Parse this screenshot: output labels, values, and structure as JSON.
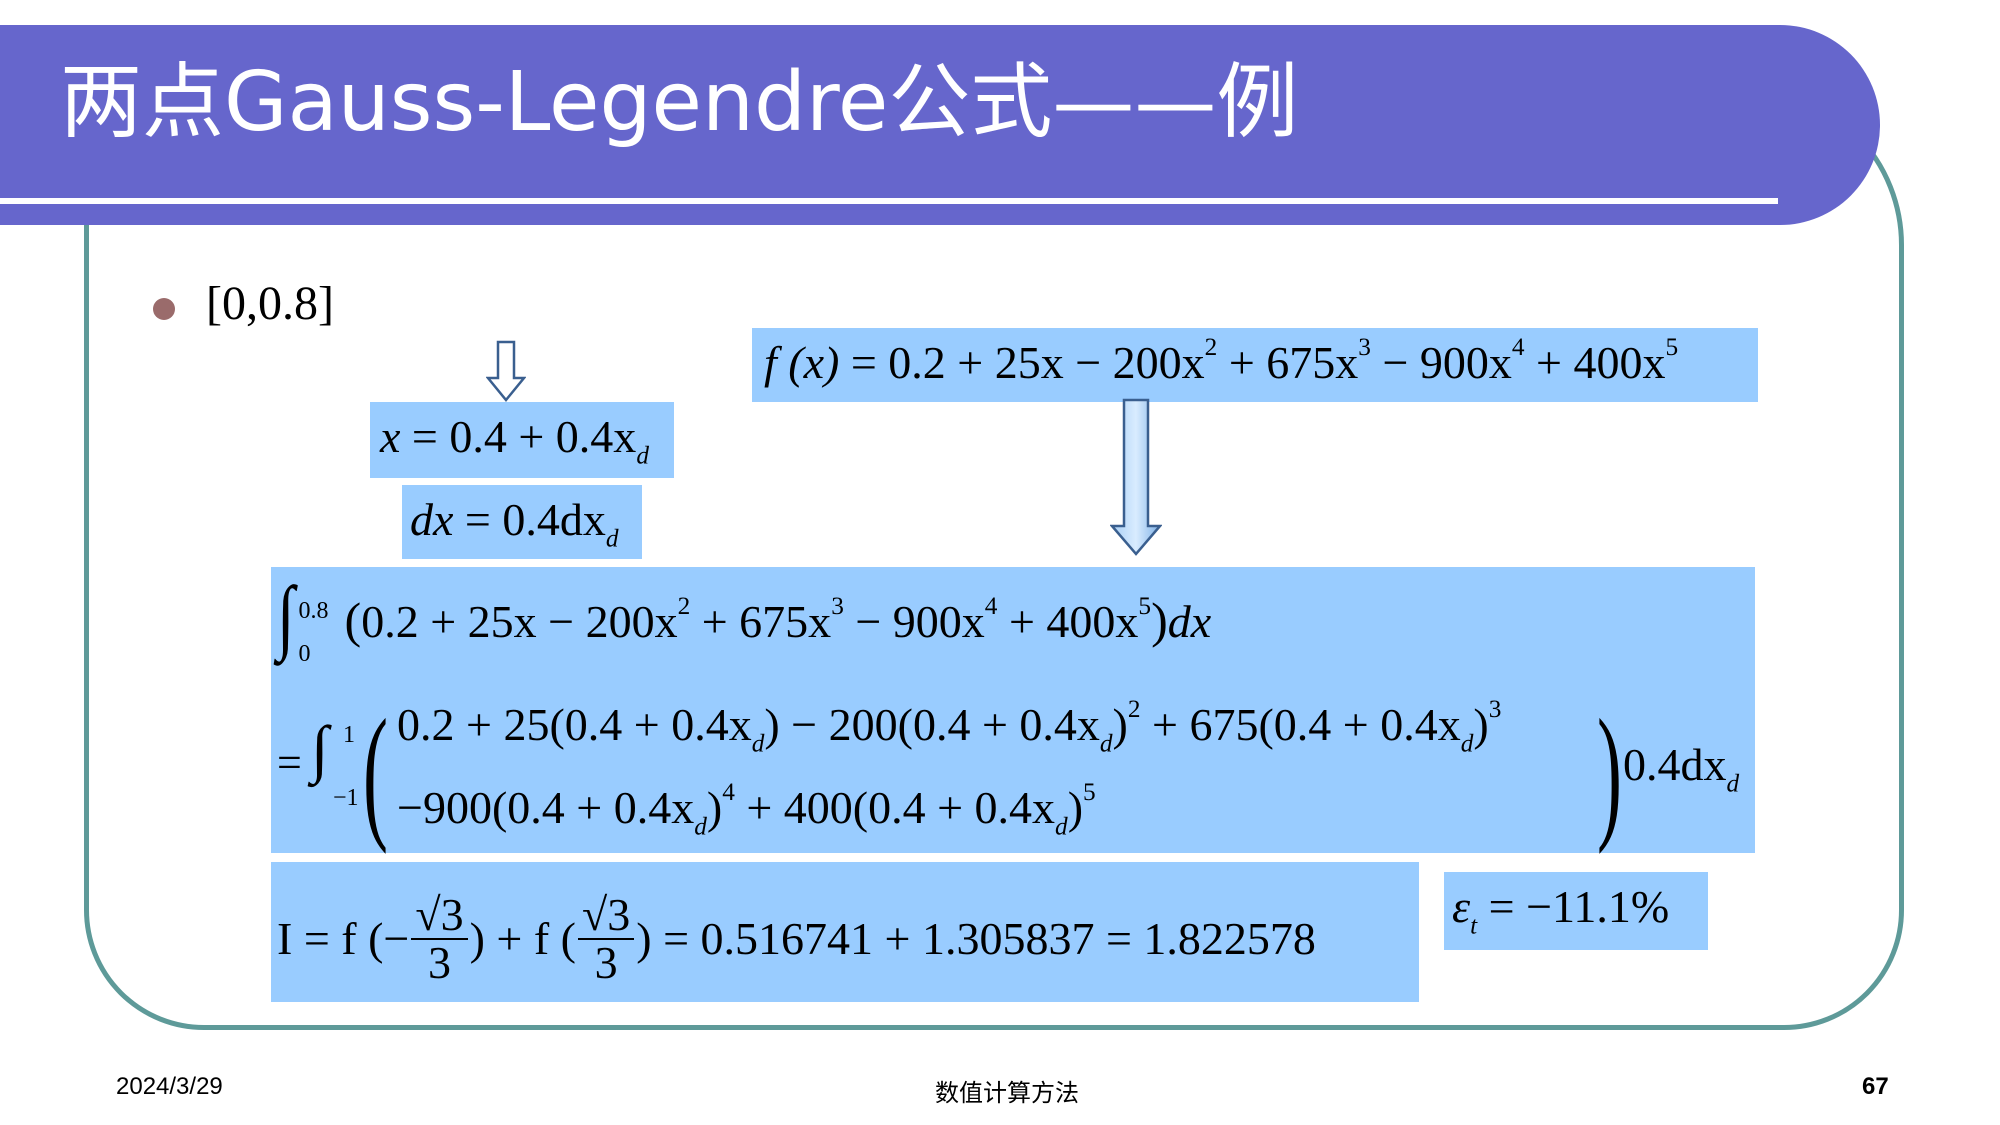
{
  "slide": {
    "title": "两点Gauss-Legendre公式——例",
    "bullet": "[0,0.8]",
    "footer": {
      "date": "2024/3/29",
      "course": "数值计算方法",
      "page": "67"
    }
  },
  "formulas": {
    "f": {
      "lhs": "f (x)",
      "rhs_parts": [
        "= 0.2 + 25x − 200x",
        "2",
        " + 675x",
        "3",
        " − 900x",
        "4",
        " + 400x",
        "5"
      ]
    },
    "x_sub": {
      "lhs": "x",
      "rhs": " = 0.4 + 0.4x",
      "sub": "d"
    },
    "dx_sub": {
      "lhs": "dx",
      "rhs": " = 0.4dx",
      "sub": "d"
    },
    "integral": {
      "upper": "0.8",
      "lower": "0",
      "body_parts": [
        "0.2 + 25x − 200x",
        "2",
        " + 675x",
        "3",
        " − 900x",
        "4",
        " + 400x",
        "5"
      ],
      "dx": "dx",
      "upper2": "1",
      "lower2": "−1",
      "line1_parts": [
        "0.2 + 25(0.4 + 0.4x",
        "d",
        ") − 200(0.4 + 0.4x",
        "d",
        ")",
        "2",
        " + 675(0.4 + 0.4x",
        "d",
        ")",
        "3"
      ],
      "line2_parts": [
        "−900(0.4 + 0.4x",
        "d",
        ")",
        "4",
        " + 400(0.4 + 0.4x",
        "d",
        ")",
        "5"
      ],
      "factor": "0.4dx",
      "factor_sub": "d"
    },
    "result": {
      "prefix": "I = f (−",
      "sqrt_num": "√3",
      "den": "3",
      "mid": ") + f (",
      "suffix": ") = 0.516741 + 1.305837 = 1.822578"
    },
    "error": {
      "symbol": "ε",
      "sub": "t",
      "value": " = −11.1%"
    }
  }
}
